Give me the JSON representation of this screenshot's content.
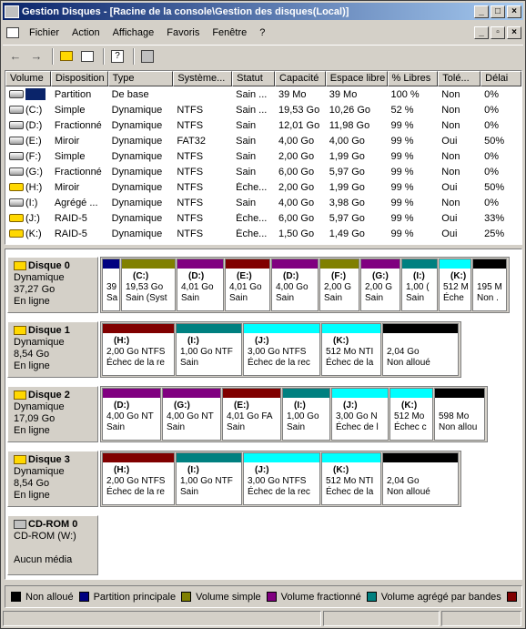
{
  "window": {
    "title": "Gestion Disques - [Racine de la console\\Gestion des disques(Local)]"
  },
  "menu": [
    "Fichier",
    "Action",
    "Affichage",
    "Favoris",
    "Fenêtre",
    "?"
  ],
  "columns": [
    "Volume",
    "Disposition",
    "Type",
    "Système...",
    "Statut",
    "Capacité",
    "Espace libre",
    "% Libres",
    "Tolé...",
    "Délai"
  ],
  "rows": [
    [
      "",
      "Partition",
      "De base",
      "",
      "Sain ...",
      "39 Mo",
      "39 Mo",
      "100 %",
      "Non",
      "0%"
    ],
    [
      "(C:)",
      "Simple",
      "Dynamique",
      "NTFS",
      "Sain ...",
      "19,53 Go",
      "10,26 Go",
      "52 %",
      "Non",
      "0%"
    ],
    [
      "(D:)",
      "Fractionné",
      "Dynamique",
      "NTFS",
      "Sain",
      "12,01 Go",
      "11,98 Go",
      "99 %",
      "Non",
      "0%"
    ],
    [
      "(E:)",
      "Miroir",
      "Dynamique",
      "FAT32",
      "Sain",
      "4,00 Go",
      "4,00 Go",
      "99 %",
      "Oui",
      "50%"
    ],
    [
      "(F:)",
      "Simple",
      "Dynamique",
      "NTFS",
      "Sain",
      "2,00 Go",
      "1,99 Go",
      "99 %",
      "Non",
      "0%"
    ],
    [
      "(G:)",
      "Fractionné",
      "Dynamique",
      "NTFS",
      "Sain",
      "6,00 Go",
      "5,97 Go",
      "99 %",
      "Non",
      "0%"
    ],
    [
      "(H:)",
      "Miroir",
      "Dynamique",
      "NTFS",
      "Éche...",
      "2,00 Go",
      "1,99 Go",
      "99 %",
      "Oui",
      "50%"
    ],
    [
      "(I:)",
      "Agrégé ...",
      "Dynamique",
      "NTFS",
      "Sain",
      "4,00 Go",
      "3,98 Go",
      "99 %",
      "Non",
      "0%"
    ],
    [
      "(J:)",
      "RAID-5",
      "Dynamique",
      "NTFS",
      "Éche...",
      "6,00 Go",
      "5,97 Go",
      "99 %",
      "Oui",
      "33%"
    ],
    [
      "(K:)",
      "RAID-5",
      "Dynamique",
      "NTFS",
      "Éche...",
      "1,50 Go",
      "1,49 Go",
      "99 %",
      "Oui",
      "25%"
    ]
  ],
  "disks": [
    {
      "name": "Disque 0",
      "type": "Dynamique",
      "size": "37,27 Go",
      "status": "En ligne",
      "parts": [
        {
          "n": "",
          "l1": "39",
          "l2": "Sa",
          "c": "#000080"
        },
        {
          "n": "(C:)",
          "l1": "19,53 Go",
          "l2": "Sain (Syst",
          "c": "#808000"
        },
        {
          "n": "(D:)",
          "l1": "4,01 Go",
          "l2": "Sain",
          "c": "#800080"
        },
        {
          "n": "(E:)",
          "l1": "4,01 Go",
          "l2": "Sain",
          "c": "#800000"
        },
        {
          "n": "(D:)",
          "l1": "4,00 Go",
          "l2": "Sain",
          "c": "#800080"
        },
        {
          "n": "(F:)",
          "l1": "2,00 G",
          "l2": "Sain",
          "c": "#808000"
        },
        {
          "n": "(G:)",
          "l1": "2,00 G",
          "l2": "Sain",
          "c": "#800080"
        },
        {
          "n": "(I:)",
          "l1": "1,00 (",
          "l2": "Sain",
          "c": "#008080"
        },
        {
          "n": "(K:)",
          "l1": "512 M",
          "l2": "Éche",
          "c": "#00ffff"
        },
        {
          "n": "",
          "l1": "195 M",
          "l2": "Non .",
          "c": "#000000"
        }
      ]
    },
    {
      "name": "Disque 1",
      "type": "Dynamique",
      "size": "8,54 Go",
      "status": "En ligne",
      "parts": [
        {
          "n": "(H:)",
          "l1": "2,00 Go NTFS",
          "l2": "Échec de la re",
          "c": "#800000"
        },
        {
          "n": "(I:)",
          "l1": "1,00 Go NTF",
          "l2": "Sain",
          "c": "#008080"
        },
        {
          "n": "(J:)",
          "l1": "3,00 Go NTFS",
          "l2": "Échec de la rec",
          "c": "#00ffff"
        },
        {
          "n": "(K:)",
          "l1": "512 Mo NTI",
          "l2": "Échec de la",
          "c": "#00ffff"
        },
        {
          "n": "",
          "l1": "2,04 Go",
          "l2": "Non alloué",
          "c": "#000000"
        }
      ]
    },
    {
      "name": "Disque 2",
      "type": "Dynamique",
      "size": "17,09 Go",
      "status": "En ligne",
      "parts": [
        {
          "n": "(D:)",
          "l1": "4,00 Go NT",
          "l2": "Sain",
          "c": "#800080"
        },
        {
          "n": "(G:)",
          "l1": "4,00 Go NT",
          "l2": "Sain",
          "c": "#800080"
        },
        {
          "n": "(E:)",
          "l1": "4,01 Go FA",
          "l2": "Sain",
          "c": "#800000"
        },
        {
          "n": "(I:)",
          "l1": "1,00 Go",
          "l2": "Sain",
          "c": "#008080"
        },
        {
          "n": "(J:)",
          "l1": "3,00 Go N",
          "l2": "Échec de l",
          "c": "#00ffff"
        },
        {
          "n": "(K:)",
          "l1": "512 Mo",
          "l2": "Échec c",
          "c": "#00ffff"
        },
        {
          "n": "",
          "l1": "598 Mo",
          "l2": "Non allou",
          "c": "#000000"
        }
      ]
    },
    {
      "name": "Disque 3",
      "type": "Dynamique",
      "size": "8,54 Go",
      "status": "En ligne",
      "parts": [
        {
          "n": "(H:)",
          "l1": "2,00 Go NTFS",
          "l2": "Échec de la re",
          "c": "#800000"
        },
        {
          "n": "(I:)",
          "l1": "1,00 Go NTF",
          "l2": "Sain",
          "c": "#008080"
        },
        {
          "n": "(J:)",
          "l1": "3,00 Go NTFS",
          "l2": "Échec de la rec",
          "c": "#00ffff"
        },
        {
          "n": "(K:)",
          "l1": "512 Mo NTI",
          "l2": "Échec de la",
          "c": "#00ffff"
        },
        {
          "n": "",
          "l1": "2,04 Go",
          "l2": "Non alloué",
          "c": "#000000"
        }
      ]
    }
  ],
  "cdrom": {
    "name": "CD-ROM 0",
    "drive": "CD-ROM (W:)",
    "media": "Aucun média"
  },
  "legend": [
    {
      "label": "Non alloué",
      "c": "#000000"
    },
    {
      "label": "Partition principale",
      "c": "#000080"
    },
    {
      "label": "Volume simple",
      "c": "#808000"
    },
    {
      "label": "Volume fractionné",
      "c": "#800080"
    },
    {
      "label": "Volume agrégé par bandes",
      "c": "#008080"
    },
    {
      "label": "",
      "c": "#800000"
    }
  ]
}
